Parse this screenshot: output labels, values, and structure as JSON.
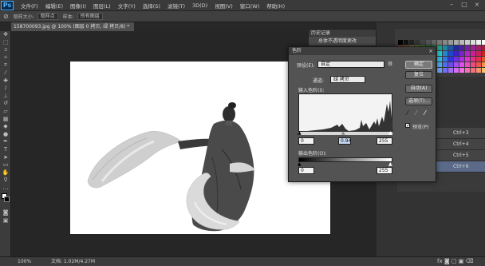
{
  "app": {
    "logo": "Ps"
  },
  "menubar": {
    "items": [
      "文件(F)",
      "编辑(E)",
      "图像(I)",
      "图层(L)",
      "文字(Y)",
      "选择(S)",
      "滤镜(T)",
      "3D(D)",
      "视图(V)",
      "窗口(W)",
      "帮助(H)"
    ]
  },
  "options": {
    "feather_label": "取样大小:",
    "feather_value": "取样点",
    "sample_label": "样本:",
    "sample_value": "所有图层"
  },
  "document": {
    "tab_title": "158700093.jpg @ 100% (图层 0 拷贝, 绿 拷贝/8) *"
  },
  "history": {
    "title": "历史记录",
    "item": "总体不透明度更改"
  },
  "statusbar": {
    "zoom": "100%",
    "doc_info": "文档: 1.02M/4.27M"
  },
  "layers": {
    "rows": [
      "Ctrl+3",
      "Ctrl+4",
      "Ctrl+5",
      "Ctrl+6"
    ]
  },
  "levels_dialog": {
    "title": "色阶",
    "preset_label": "预设(E):",
    "preset_value": "自定",
    "channel_label": "通道:",
    "channel_value": "绿 拷贝",
    "input_label": "输入色阶(I):",
    "input_black": "0",
    "input_gamma": "0.94",
    "input_white": "255",
    "output_label": "输出色阶(O):",
    "output_black": "0",
    "output_white": "255",
    "ok_label": "确定",
    "reset_label": "复位",
    "auto_label": "自动(A)",
    "options_label": "选项(T)...",
    "preview_label": "预览(P)",
    "preview_checked": "✓",
    "close_glyph": "×"
  },
  "colors": {
    "accent": "#4fb0ff",
    "selection": "#5a6a88"
  },
  "icons": [
    "move-icon",
    "marquee-icon",
    "lasso-icon",
    "wand-icon",
    "crop-icon",
    "eyedropper-icon",
    "brush-icon",
    "stamp-icon",
    "eraser-icon",
    "gradient-icon",
    "dodge-icon",
    "pen-icon",
    "type-icon",
    "path-icon",
    "shape-icon",
    "hand-icon",
    "zoom-icon"
  ]
}
